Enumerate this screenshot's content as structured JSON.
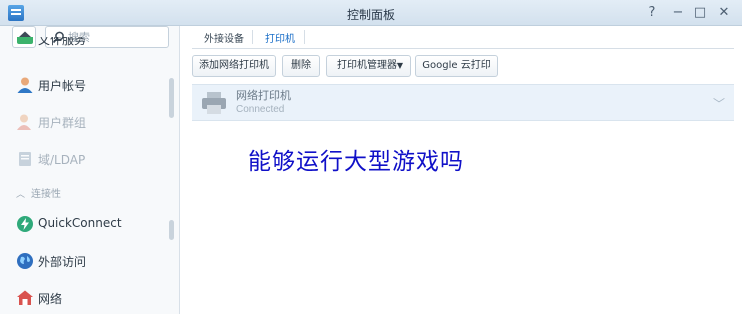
{
  "window": {
    "title": "控制面板"
  },
  "sidebar": {
    "search_placeholder": "搜索",
    "items": [
      {
        "label": "文件服务",
        "icon": "file-services-icon"
      },
      {
        "label": "用户帐号",
        "icon": "user-icon"
      },
      {
        "label": "用户群组",
        "icon": "group-icon"
      },
      {
        "label": "域/LDAP",
        "icon": "domain-icon"
      },
      {
        "label": "QuickConnect",
        "icon": "quickconnect-icon"
      },
      {
        "label": "外部访问",
        "icon": "globe-icon"
      },
      {
        "label": "网络",
        "icon": "network-icon"
      }
    ],
    "section_connectivity": "连接性"
  },
  "tabs": [
    {
      "label": "外接设备"
    },
    {
      "label": "打印机"
    }
  ],
  "toolbar": {
    "add_network_printer": "添加网络打印机",
    "delete": "删除",
    "printer_manager": "打印机管理器",
    "google_cloud_print": "Google 云打印"
  },
  "printer": {
    "name": "网络打印机",
    "status": "Connected"
  },
  "overlay": {
    "text": "能够运行大型游戏吗"
  },
  "colors": {
    "accent": "#1b6fc8",
    "overlay_text": "#1010c8",
    "selected_row": "#eaf2fa"
  }
}
